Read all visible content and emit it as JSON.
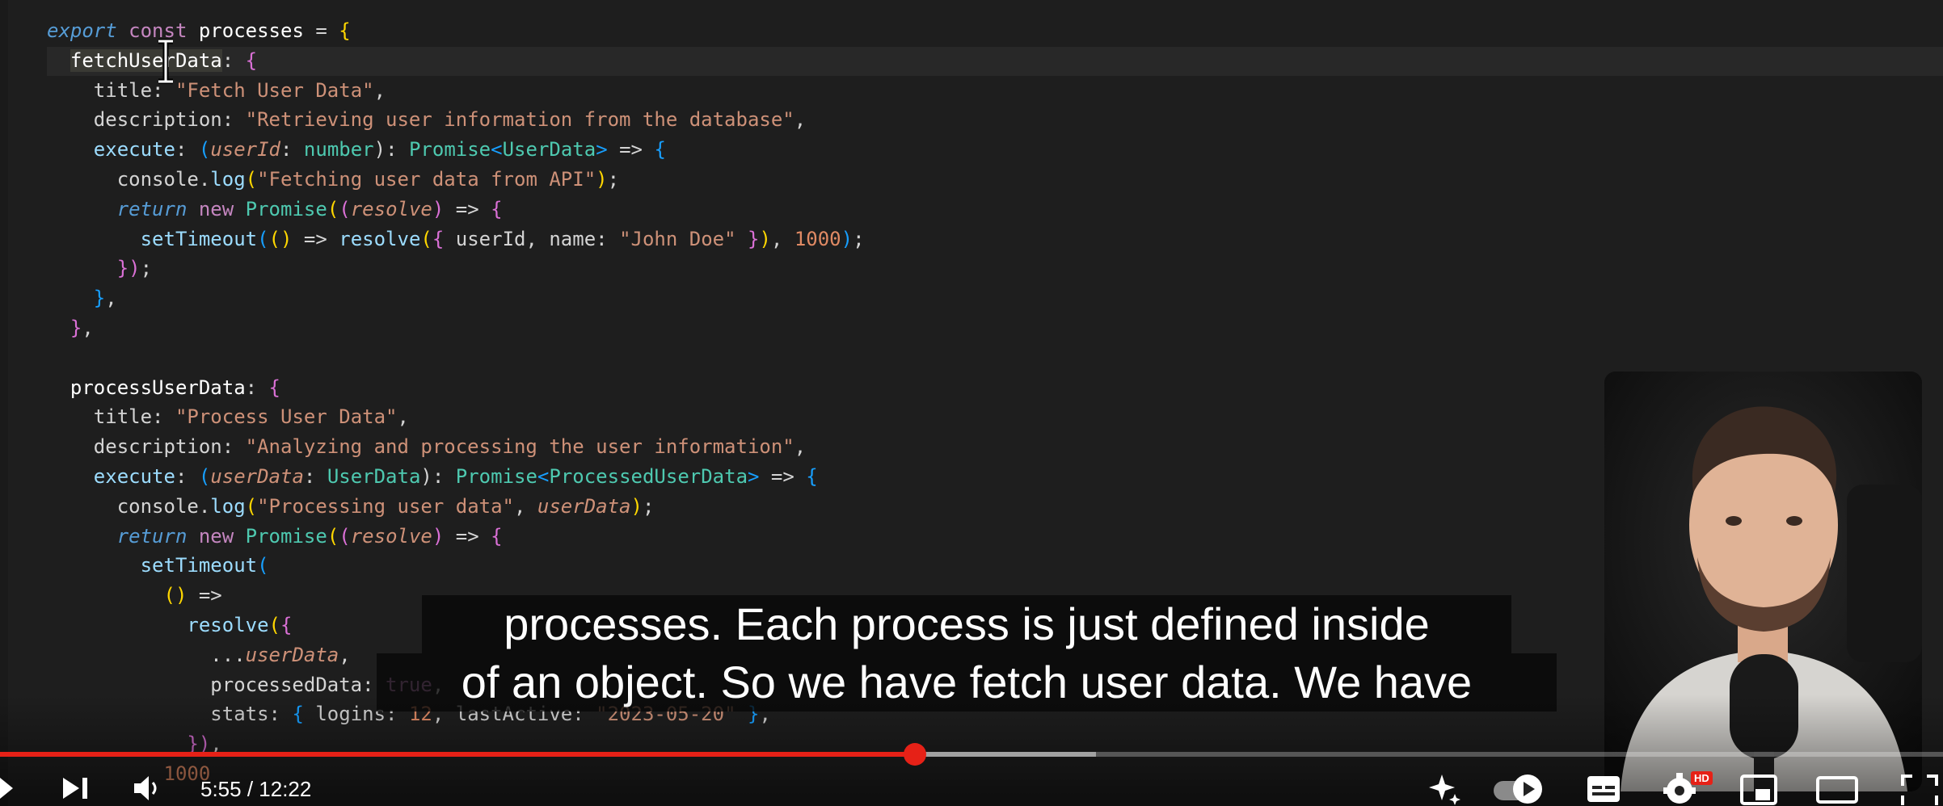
{
  "code_lines": [
    [
      {
        "t": "export ",
        "c": "kw"
      },
      {
        "t": "const ",
        "c": "kw2"
      },
      {
        "t": "processes",
        "c": "vr"
      },
      {
        "t": " = ",
        "c": ""
      },
      {
        "t": "{",
        "c": "br1"
      }
    ],
    [
      {
        "t": "  ",
        "c": ""
      },
      {
        "t": "fetchUserData",
        "c": "vr sel"
      },
      {
        "t": ": ",
        "c": ""
      },
      {
        "t": "{",
        "c": "br2"
      }
    ],
    [
      {
        "t": "    title: ",
        "c": ""
      },
      {
        "t": "\"Fetch User Data\"",
        "c": "str"
      },
      {
        "t": ",",
        "c": ""
      }
    ],
    [
      {
        "t": "    description: ",
        "c": ""
      },
      {
        "t": "\"Retrieving user information from the database\"",
        "c": "str"
      },
      {
        "t": ",",
        "c": ""
      }
    ],
    [
      {
        "t": "    ",
        "c": ""
      },
      {
        "t": "execute",
        "c": "fn"
      },
      {
        "t": ": ",
        "c": ""
      },
      {
        "t": "(",
        "c": "br3"
      },
      {
        "t": "userId",
        "c": "par"
      },
      {
        "t": ": ",
        "c": ""
      },
      {
        "t": "number",
        "c": "tp"
      },
      {
        "t": "): ",
        "c": ""
      },
      {
        "t": "Promise",
        "c": "tp"
      },
      {
        "t": "<",
        "c": "br3"
      },
      {
        "t": "UserData",
        "c": "tp"
      },
      {
        "t": ">",
        "c": "br3"
      },
      {
        "t": " => ",
        "c": ""
      },
      {
        "t": "{",
        "c": "br3"
      }
    ],
    [
      {
        "t": "      console.",
        "c": ""
      },
      {
        "t": "log",
        "c": "fn"
      },
      {
        "t": "(",
        "c": "br1"
      },
      {
        "t": "\"Fetching user data from API\"",
        "c": "str"
      },
      {
        "t": ")",
        "c": "br1"
      },
      {
        "t": ";",
        "c": ""
      }
    ],
    [
      {
        "t": "      ",
        "c": ""
      },
      {
        "t": "return ",
        "c": "kw"
      },
      {
        "t": "new ",
        "c": "kw2"
      },
      {
        "t": "Promise",
        "c": "tp"
      },
      {
        "t": "(",
        "c": "br1"
      },
      {
        "t": "(",
        "c": "br2"
      },
      {
        "t": "resolve",
        "c": "par"
      },
      {
        "t": ")",
        "c": "br2"
      },
      {
        "t": " => ",
        "c": ""
      },
      {
        "t": "{",
        "c": "br2"
      }
    ],
    [
      {
        "t": "        ",
        "c": ""
      },
      {
        "t": "setTimeout",
        "c": "fn"
      },
      {
        "t": "(",
        "c": "br3"
      },
      {
        "t": "()",
        "c": "br1"
      },
      {
        "t": " => ",
        "c": ""
      },
      {
        "t": "resolve",
        "c": "fn"
      },
      {
        "t": "(",
        "c": "br1"
      },
      {
        "t": "{ ",
        "c": "br2"
      },
      {
        "t": "userId, name: ",
        "c": ""
      },
      {
        "t": "\"John Doe\"",
        "c": "str"
      },
      {
        "t": " }",
        "c": "br2"
      },
      {
        "t": ")",
        "c": "br1"
      },
      {
        "t": ", ",
        "c": ""
      },
      {
        "t": "1000",
        "c": "num"
      },
      {
        "t": ")",
        "c": "br3"
      },
      {
        "t": ";",
        "c": ""
      }
    ],
    [
      {
        "t": "      ",
        "c": ""
      },
      {
        "t": "})",
        "c": "br2"
      },
      {
        "t": ";",
        "c": ""
      }
    ],
    [
      {
        "t": "    ",
        "c": ""
      },
      {
        "t": "}",
        "c": "br3"
      },
      {
        "t": ",",
        "c": ""
      }
    ],
    [
      {
        "t": "  ",
        "c": ""
      },
      {
        "t": "}",
        "c": "br2"
      },
      {
        "t": ",",
        "c": ""
      }
    ],
    [
      {
        "t": "",
        "c": ""
      }
    ],
    [
      {
        "t": "  processUserData",
        "c": "vr"
      },
      {
        "t": ": ",
        "c": ""
      },
      {
        "t": "{",
        "c": "br2"
      }
    ],
    [
      {
        "t": "    title: ",
        "c": ""
      },
      {
        "t": "\"Process User Data\"",
        "c": "str"
      },
      {
        "t": ",",
        "c": ""
      }
    ],
    [
      {
        "t": "    description: ",
        "c": ""
      },
      {
        "t": "\"Analyzing and processing the user information\"",
        "c": "str"
      },
      {
        "t": ",",
        "c": ""
      }
    ],
    [
      {
        "t": "    ",
        "c": ""
      },
      {
        "t": "execute",
        "c": "fn"
      },
      {
        "t": ": ",
        "c": ""
      },
      {
        "t": "(",
        "c": "br3"
      },
      {
        "t": "userData",
        "c": "par"
      },
      {
        "t": ": ",
        "c": ""
      },
      {
        "t": "UserData",
        "c": "tp"
      },
      {
        "t": "): ",
        "c": ""
      },
      {
        "t": "Promise",
        "c": "tp"
      },
      {
        "t": "<",
        "c": "br3"
      },
      {
        "t": "ProcessedUserData",
        "c": "tp"
      },
      {
        "t": ">",
        "c": "br3"
      },
      {
        "t": " => ",
        "c": ""
      },
      {
        "t": "{",
        "c": "br3"
      }
    ],
    [
      {
        "t": "      console.",
        "c": ""
      },
      {
        "t": "log",
        "c": "fn"
      },
      {
        "t": "(",
        "c": "br1"
      },
      {
        "t": "\"Processing user data\"",
        "c": "str"
      },
      {
        "t": ", ",
        "c": ""
      },
      {
        "t": "userData",
        "c": "par"
      },
      {
        "t": ")",
        "c": "br1"
      },
      {
        "t": ";",
        "c": ""
      }
    ],
    [
      {
        "t": "      ",
        "c": ""
      },
      {
        "t": "return ",
        "c": "kw"
      },
      {
        "t": "new ",
        "c": "kw2"
      },
      {
        "t": "Promise",
        "c": "tp"
      },
      {
        "t": "(",
        "c": "br1"
      },
      {
        "t": "(",
        "c": "br2"
      },
      {
        "t": "resolve",
        "c": "par"
      },
      {
        "t": ")",
        "c": "br2"
      },
      {
        "t": " => ",
        "c": ""
      },
      {
        "t": "{",
        "c": "br2"
      }
    ],
    [
      {
        "t": "        ",
        "c": ""
      },
      {
        "t": "setTimeout",
        "c": "fn"
      },
      {
        "t": "(",
        "c": "br3"
      }
    ],
    [
      {
        "t": "          ",
        "c": ""
      },
      {
        "t": "()",
        "c": "br1"
      },
      {
        "t": " =>",
        "c": ""
      }
    ],
    [
      {
        "t": "            ",
        "c": ""
      },
      {
        "t": "resolve",
        "c": "fn"
      },
      {
        "t": "(",
        "c": "br1"
      },
      {
        "t": "{",
        "c": "br2"
      }
    ],
    [
      {
        "t": "              ...",
        "c": ""
      },
      {
        "t": "userData",
        "c": "par"
      },
      {
        "t": ",",
        "c": ""
      }
    ],
    [
      {
        "t": "              processedData: ",
        "c": ""
      },
      {
        "t": "true",
        "c": "kw2"
      },
      {
        "t": ",",
        "c": ""
      }
    ],
    [
      {
        "t": "              stats: ",
        "c": ""
      },
      {
        "t": "{ ",
        "c": "br3"
      },
      {
        "t": "logins: ",
        "c": ""
      },
      {
        "t": "12",
        "c": "num"
      },
      {
        "t": ", lastActive: ",
        "c": ""
      },
      {
        "t": "\"2023-05-20\"",
        "c": "str"
      },
      {
        "t": " }",
        "c": "br3"
      },
      {
        "t": ",",
        "c": ""
      }
    ],
    [
      {
        "t": "            ",
        "c": ""
      },
      {
        "t": "})",
        "c": "br2"
      },
      {
        "t": ",",
        "c": ""
      }
    ],
    [
      {
        "t": "          ",
        "c": ""
      },
      {
        "t": "1000",
        "c": "num"
      }
    ]
  ],
  "captions": {
    "line1": "processes. Each process is just defined inside",
    "line2": "of an object. So we have fetch user data. We have"
  },
  "player": {
    "time_display": "5:55 / 12:22",
    "progress_played": 0.471,
    "progress_buffered": 0.564,
    "accent_color": "#e62117",
    "hd_badge": "HD"
  },
  "icons": [
    "play-icon",
    "next-icon",
    "volume-icon",
    "sparkle-icon",
    "autoplay-toggle",
    "subtitles-icon",
    "settings-icon",
    "miniplayer-icon",
    "theater-icon",
    "fullscreen-icon"
  ]
}
